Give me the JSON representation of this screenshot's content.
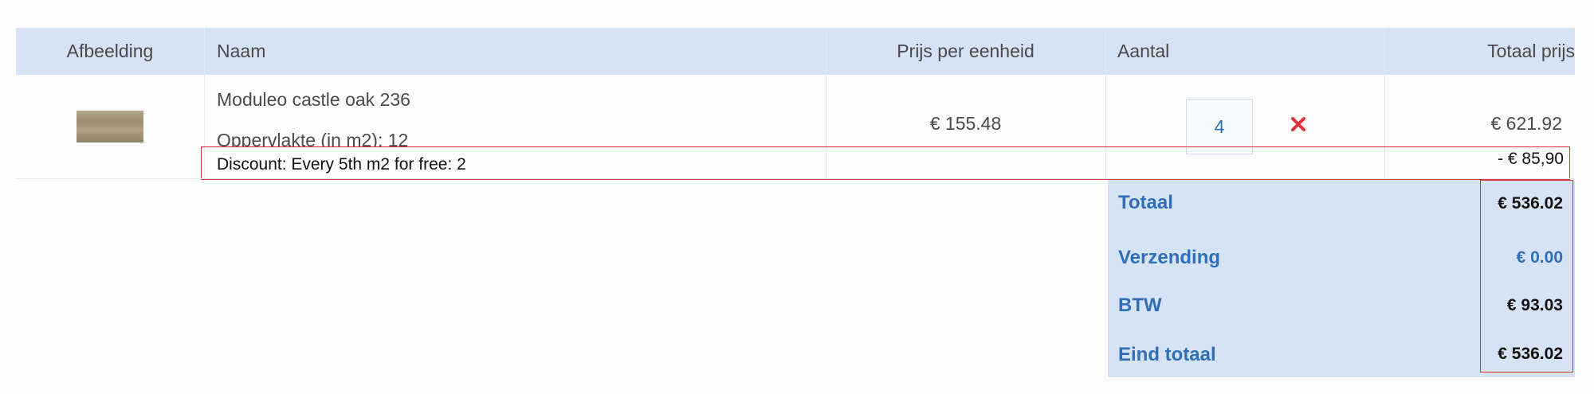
{
  "table": {
    "headers": {
      "image": "Afbeelding",
      "name": "Naam",
      "unit_price": "Prijs per eenheid",
      "quantity": "Aantal",
      "total_price": "Totaal prijs"
    },
    "rows": [
      {
        "name": "Moduleo castle oak 236",
        "area": "Oppervlakte (in m2): 12",
        "unit_price": "€ 155.48",
        "quantity": "4",
        "total": "€ 621.92"
      }
    ],
    "discount": {
      "label": "Discount: Every 5th m2 for free: 2",
      "amount": "- € 85,90"
    }
  },
  "summary": {
    "totaal_label": "Totaal",
    "totaal_value": "€ 536.02",
    "verzending_label": "Verzending",
    "verzending_value": "€ 0.00",
    "btw_label": "BTW",
    "btw_value": "€ 93.03",
    "eind_label": "Eind totaal",
    "eind_value": "€ 536.02"
  },
  "colors": {
    "header_bg": "#d6e3f4",
    "accent_blue": "#2f6fb8",
    "remove_red": "#e2333a",
    "highlight_border": "#d9343b"
  },
  "icons": {
    "remove": "close-icon"
  }
}
